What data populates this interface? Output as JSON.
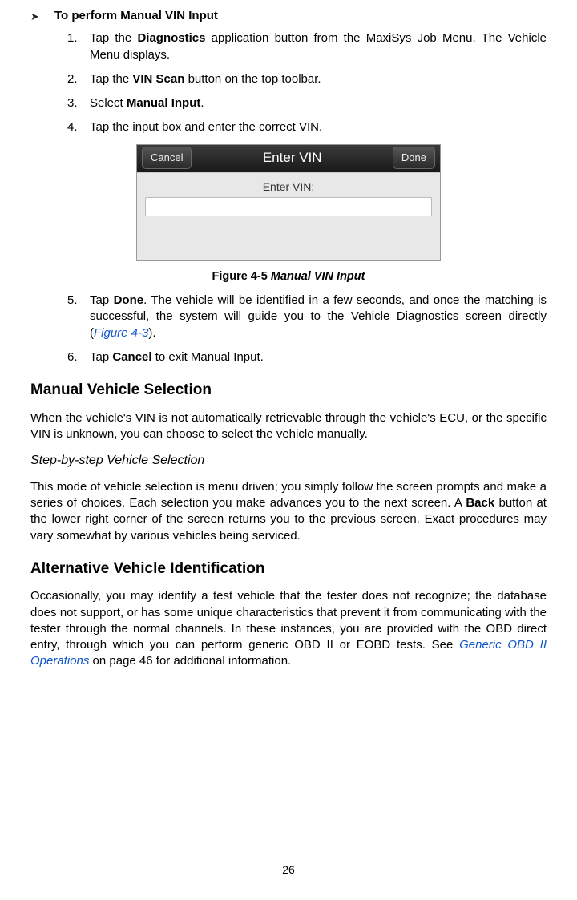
{
  "bullet": {
    "title": "To perform Manual VIN Input"
  },
  "steps1": [
    {
      "num": "1.",
      "pre": "Tap the ",
      "bold": "Diagnostics",
      "post": " application button from the MaxiSys Job Menu. The Vehicle Menu displays."
    },
    {
      "num": "2.",
      "pre": "Tap the ",
      "bold": "VIN Scan",
      "post": " button on the top toolbar."
    },
    {
      "num": "3.",
      "pre": "Select ",
      "bold": "Manual Input",
      "post": "."
    },
    {
      "num": "4.",
      "pre": "Tap the input box and enter the correct VIN.",
      "bold": "",
      "post": ""
    }
  ],
  "screenshot": {
    "cancel": "Cancel",
    "title": "Enter VIN",
    "done": "Done",
    "label": "Enter VIN:"
  },
  "figcaption": {
    "prefix": "Figure 4-5 ",
    "italic": "Manual VIN Input"
  },
  "steps2": [
    {
      "num": "5.",
      "pre": "Tap ",
      "bold": "Done",
      "mid": ". The vehicle will be identified in a few seconds, and once the matching is successful, the system will guide you to the Vehicle Diagnostics screen directly (",
      "link": "Figure 4-3",
      "post": ")."
    },
    {
      "num": "6.",
      "pre": "Tap ",
      "bold": "Cancel",
      "mid": " to exit Manual Input.",
      "link": "",
      "post": ""
    }
  ],
  "h2_1": "Manual Vehicle Selection",
  "para1": "When the vehicle's VIN is not automatically retrievable through the vehicle's ECU, or the specific VIN is unknown, you can choose to select the vehicle manually.",
  "h3": "Step-by-step Vehicle Selection",
  "para2_pre": "This mode of vehicle selection is menu driven; you simply follow the screen prompts and make a series of choices. Each selection you make advances you to the next screen. A ",
  "para2_bold": "Back",
  "para2_post": " button at the lower right corner of the screen returns you to the previous screen. Exact procedures may vary somewhat by various vehicles being serviced.",
  "h2_2": "Alternative Vehicle Identification",
  "para3_pre": "Occasionally, you may identify a test vehicle that the tester does not recognize; the database does not support, or has some unique characteristics that prevent it from communicating with the tester through the normal channels. In these instances, you are provided with the OBD direct entry, through which you can perform generic OBD II or EOBD tests. See ",
  "para3_link": "Generic OBD II Operations",
  "para3_post": " on page 46 for additional information.",
  "page": "26"
}
